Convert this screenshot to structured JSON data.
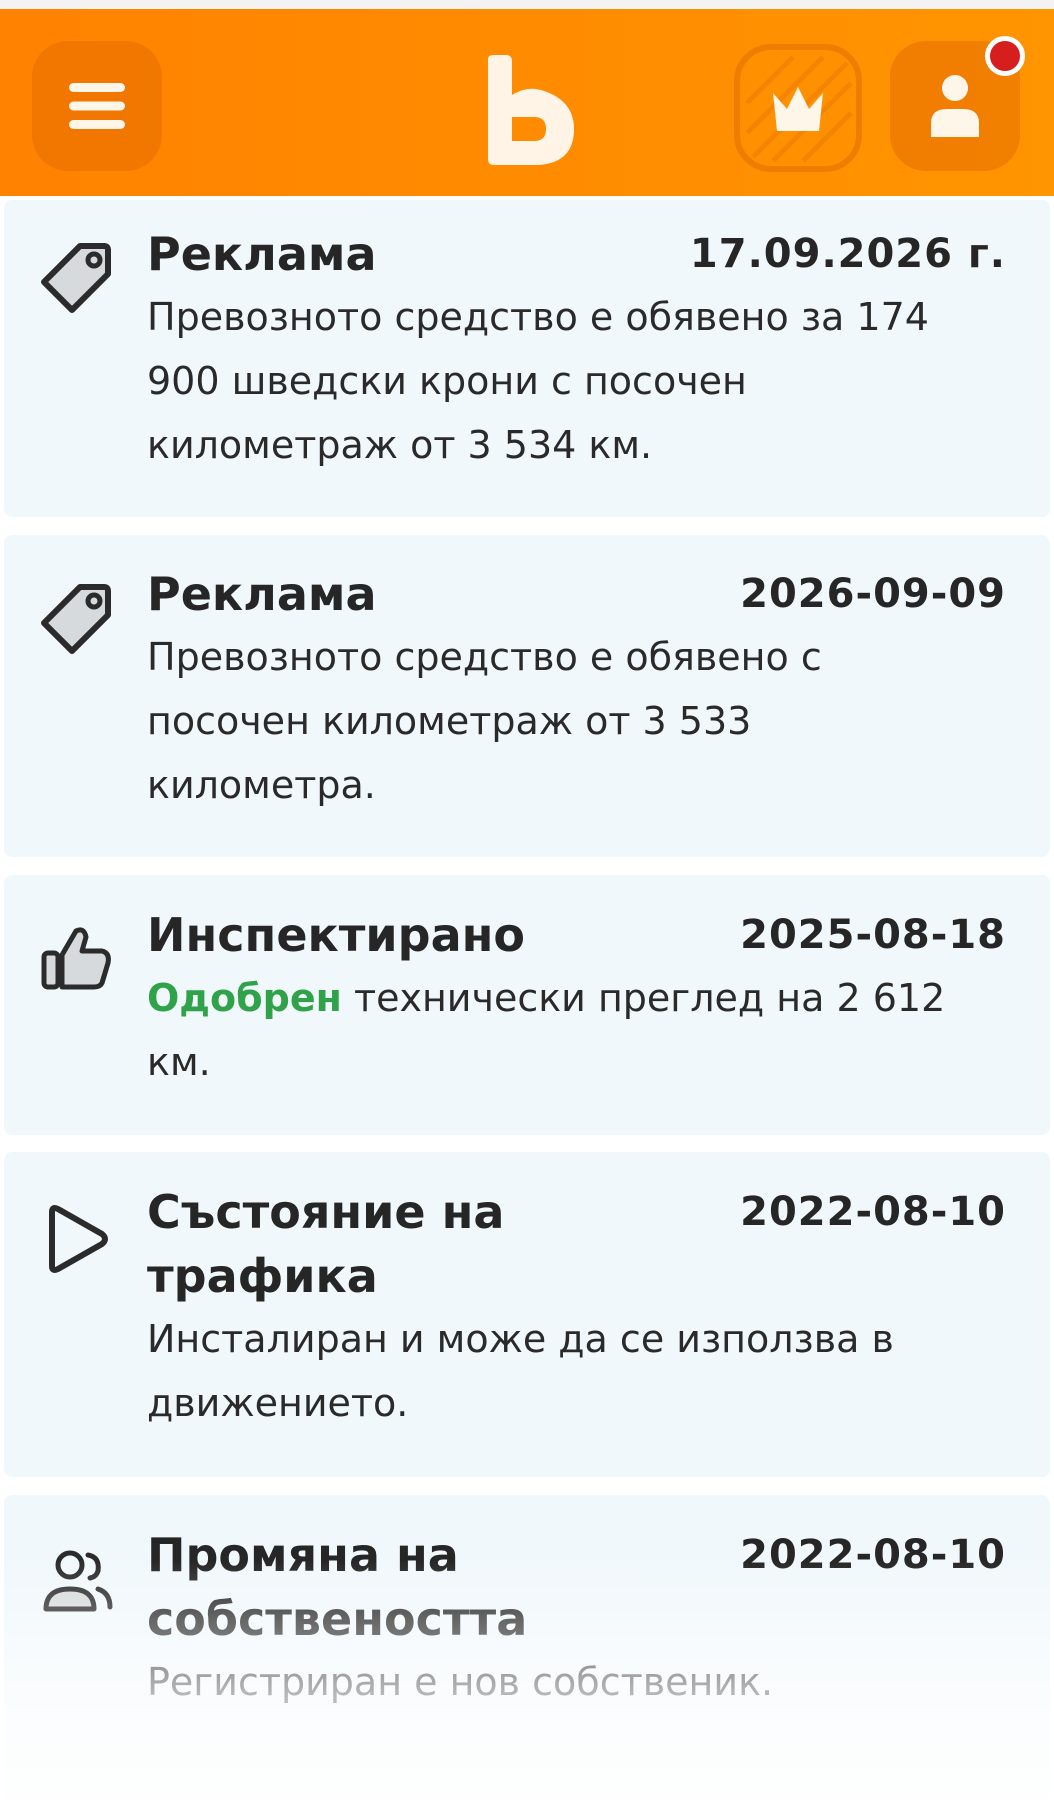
{
  "header": {
    "menu_icon": "hamburger-menu-icon",
    "logo_icon": "brand-logo-b-icon",
    "premium_icon": "crown-icon",
    "profile_icon": "user-icon",
    "notification_badge_color": "#d71e1e",
    "accent": "#ff8a00"
  },
  "events": [
    {
      "icon": "price-tag-icon",
      "title": "Реклама",
      "date": "17.09.2026 г.",
      "description": "Превозното средство е обявено за 174 900 шведски крони с посочен километраж от 3 534 км."
    },
    {
      "icon": "price-tag-icon",
      "title": "Реклама",
      "date": "2026-09-09",
      "description": "Превозното средство е обявено с посочен километраж от 3 533 километра."
    },
    {
      "icon": "thumbs-up-icon",
      "title": "Инспектирано",
      "date": "2025-08-18",
      "status": "Одобрен",
      "description": " технически преглед на 2 612 км."
    },
    {
      "icon": "play-icon",
      "title": "Състояние на трафика",
      "date": "2022-08-10",
      "description": "Инсталиран и може да се използва в движението."
    },
    {
      "icon": "users-icon",
      "title": "Промяна на собствеността",
      "date": "2022-08-10",
      "description": "Регистриран е нов собственик."
    }
  ],
  "colors": {
    "card_background": "#f1f8fb",
    "status_green": "#2fa24a"
  }
}
